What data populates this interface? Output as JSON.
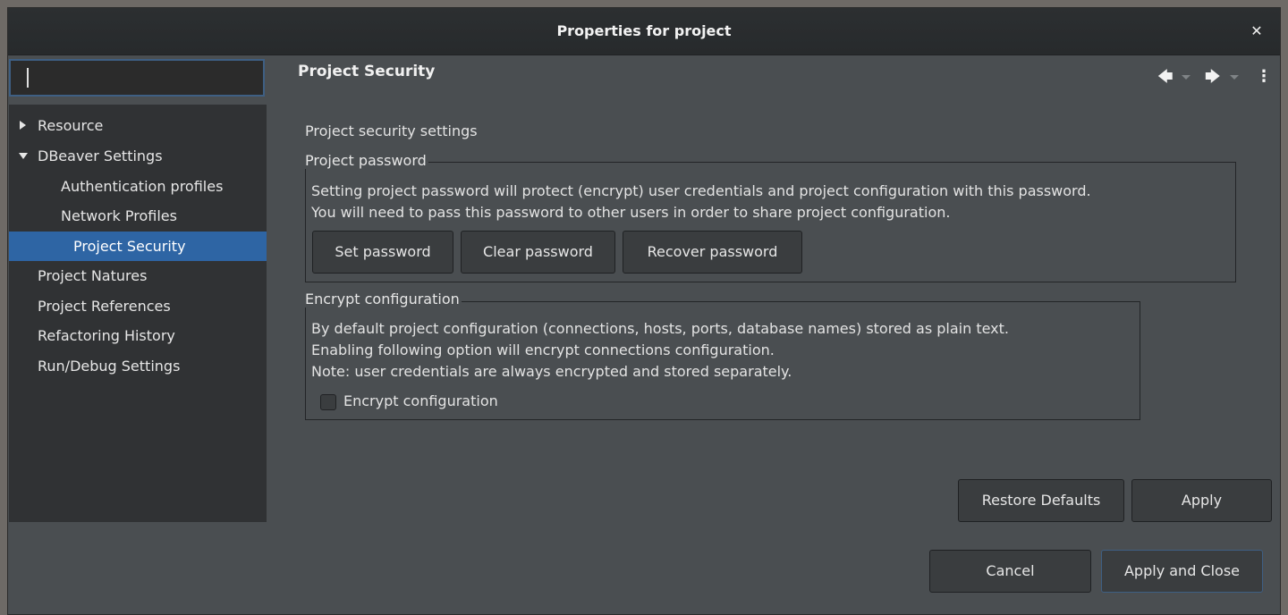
{
  "window": {
    "title": "Properties for project"
  },
  "search": {
    "value": "",
    "placeholder": ""
  },
  "tree": {
    "items": [
      {
        "label": "Resource"
      },
      {
        "label": "DBeaver Settings"
      },
      {
        "label": "Authentication profiles"
      },
      {
        "label": "Network Profiles"
      },
      {
        "label": "Project Security"
      },
      {
        "label": "Project Natures"
      },
      {
        "label": "Project References"
      },
      {
        "label": "Refactoring History"
      },
      {
        "label": "Run/Debug Settings"
      }
    ]
  },
  "page": {
    "heading": "Project Security",
    "subtitle": "Project security settings",
    "password_group": {
      "label": "Project password",
      "line1": "Setting project password will protect (encrypt) user credentials and project configuration with this password.",
      "line2": "You will need to pass this password to other users in order to share project configuration.",
      "set_button": "Set password",
      "clear_button": "Clear password",
      "recover_button": "Recover password"
    },
    "encrypt_group": {
      "label": "Encrypt configuration",
      "line1": "By default project configuration (connections, hosts, ports, database names) stored as plain text.",
      "line2": "Enabling following option will encrypt connections configuration.",
      "line3": "Note: user credentials are always encrypted and stored separately.",
      "checkbox_label": "Encrypt configuration",
      "checkbox_checked": false
    }
  },
  "buttons": {
    "restore_defaults": "Restore Defaults",
    "apply": "Apply",
    "cancel": "Cancel",
    "apply_and_close": "Apply and Close"
  },
  "icons": {
    "close": "close-icon",
    "back": "arrow-left-icon",
    "forward": "arrow-right-icon",
    "menu": "kebab-menu-icon"
  }
}
